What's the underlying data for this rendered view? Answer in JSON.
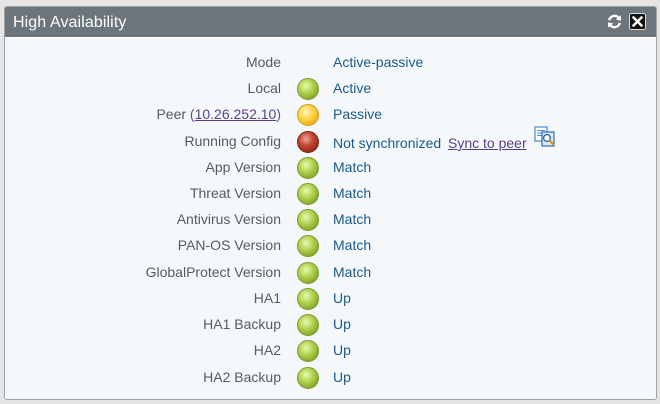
{
  "window": {
    "title": "High Availability",
    "refresh_icon": "refresh-icon",
    "close_icon": "close-icon"
  },
  "colors": {
    "titlebar": "#6c757b",
    "value_text": "#1a5a8a",
    "link": "#5b3e8a",
    "status_green": "#a4c63f",
    "status_yellow": "#f4b81c",
    "status_red": "#a8341e"
  },
  "rows": [
    {
      "label": "Mode",
      "status": "none",
      "value": "Active-passive"
    },
    {
      "label": "Local",
      "status": "green",
      "value": "Active"
    },
    {
      "label_prefix": "Peer (",
      "label_link": "10.26.252.10",
      "label_suffix": ")",
      "status": "yellow",
      "value": "Passive"
    },
    {
      "label": "Running Config",
      "status": "red",
      "value": "Not synchronized",
      "action_link": "Sync to peer",
      "action_icon": "sync-config-icon"
    },
    {
      "label": "App Version",
      "status": "green",
      "value": "Match"
    },
    {
      "label": "Threat Version",
      "status": "green",
      "value": "Match"
    },
    {
      "label": "Antivirus Version",
      "status": "green",
      "value": "Match"
    },
    {
      "label": "PAN-OS Version",
      "status": "green",
      "value": "Match"
    },
    {
      "label": "GlobalProtect Version",
      "status": "green",
      "value": "Match"
    },
    {
      "label": "HA1",
      "status": "green",
      "value": "Up"
    },
    {
      "label": "HA1 Backup",
      "status": "green",
      "value": "Up"
    },
    {
      "label": "HA2",
      "status": "green",
      "value": "Up"
    },
    {
      "label": "HA2 Backup",
      "status": "green",
      "value": "Up"
    }
  ]
}
